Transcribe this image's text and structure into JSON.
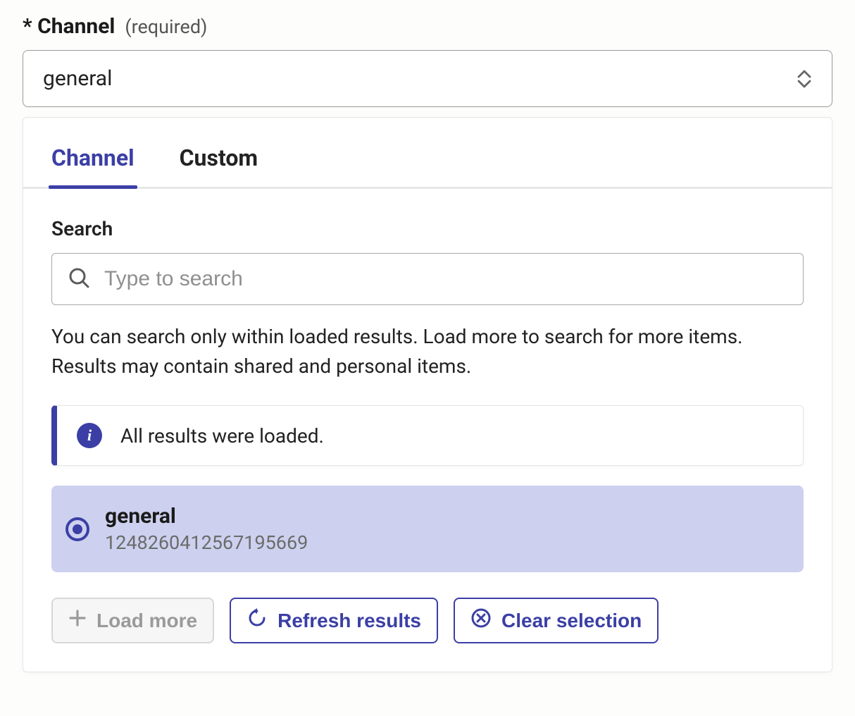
{
  "field": {
    "label": "* Channel",
    "required_hint": "(required)"
  },
  "select": {
    "value": "general"
  },
  "tabs": {
    "channel": "Channel",
    "custom": "Custom"
  },
  "search": {
    "label": "Search",
    "placeholder": "Type to search",
    "help_text": "You can search only within loaded results. Load more to search for more items. Results may contain shared and personal items."
  },
  "info_banner": {
    "message": "All results were loaded."
  },
  "results": [
    {
      "name": "general",
      "id": "1248260412567195669",
      "selected": true
    }
  ],
  "actions": {
    "load_more": "Load more",
    "refresh": "Refresh results",
    "clear": "Clear selection"
  }
}
